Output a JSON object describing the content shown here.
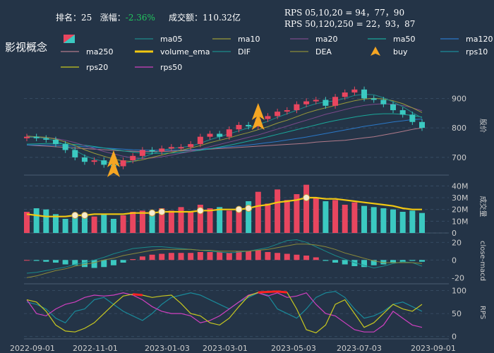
{
  "header": {
    "rank_label": "排名：",
    "rank_value": "25",
    "change_label": "涨幅：",
    "change_value": "-2.36%",
    "turnover_label": "成交额：",
    "turnover_value": "110.32亿",
    "rps_short": "RPS 05,10,20 = 94，77，90",
    "rps_long": "RPS 50,120,250 = 22，93，87"
  },
  "colors": {
    "background": "#243447",
    "up": "#e8465f",
    "down": "#3bc9c1",
    "volume_ema": "#f2c811",
    "buy": "#f5a623",
    "rps_high": "#ff2020"
  },
  "legend": [
    {
      "name": "",
      "color": "#e8465f",
      "icon": "candle-swatch-icon"
    },
    {
      "name": "ma05",
      "color": "#1f8a8a",
      "icon": "line"
    },
    {
      "name": "ma10",
      "color": "#9a9a3a",
      "icon": "line"
    },
    {
      "name": "ma20",
      "color": "#7a4a8a",
      "icon": "line"
    },
    {
      "name": "ma50",
      "color": "#1aa89a",
      "icon": "line"
    },
    {
      "name": "ma120",
      "color": "#2a78c8",
      "icon": "line"
    },
    {
      "name": "ma250",
      "color": "#b07a8a",
      "icon": "line"
    },
    {
      "name": "volume_ema",
      "color": "#f2c811",
      "icon": "thick-line"
    },
    {
      "name": "DIF",
      "color": "#1a8a8a",
      "icon": "line"
    },
    {
      "name": "DEA",
      "color": "#8a8a3a",
      "icon": "line"
    },
    {
      "name": "buy",
      "color": "#f5a623",
      "icon": "buy-arrow-icon"
    },
    {
      "name": "rps10",
      "color": "#1a8a9a",
      "icon": "line"
    },
    {
      "name": "rps20",
      "color": "#c8c820",
      "icon": "line"
    },
    {
      "name": "rps50",
      "color": "#d040c0",
      "icon": "line"
    }
  ],
  "chart_data": {
    "type": "line",
    "title": "影视概念",
    "x_ticks": [
      "2022-09-01",
      "2022-11-01",
      "2023-01-03",
      "2023-03-01",
      "2023-05-03",
      "2023-07-03",
      "2023-09-01"
    ],
    "price": {
      "ylabel": "股价",
      "ylim": [
        640,
        975
      ],
      "yticks": [
        700,
        800,
        900
      ],
      "close": [
        770,
        765,
        760,
        745,
        725,
        700,
        685,
        690,
        675,
        670,
        690,
        705,
        725,
        720,
        730,
        735,
        735,
        745,
        770,
        780,
        770,
        795,
        810,
        805,
        830,
        840,
        855,
        860,
        880,
        890,
        895,
        875,
        905,
        920,
        930,
        900,
        895,
        880,
        860,
        845,
        820,
        800
      ],
      "ma05": [
        770,
        768,
        764,
        756,
        742,
        724,
        706,
        694,
        686,
        678,
        680,
        686,
        700,
        712,
        724,
        730,
        734,
        738,
        748,
        760,
        770,
        780,
        790,
        800,
        812,
        822,
        836,
        848,
        860,
        872,
        882,
        888,
        892,
        900,
        910,
        914,
        912,
        902,
        888,
        872,
        852,
        834
      ],
      "ma10": [
        772,
        770,
        768,
        762,
        752,
        740,
        726,
        714,
        704,
        694,
        688,
        686,
        692,
        700,
        708,
        716,
        724,
        732,
        740,
        750,
        758,
        766,
        776,
        784,
        794,
        804,
        816,
        826,
        838,
        850,
        860,
        868,
        876,
        884,
        892,
        898,
        900,
        898,
        892,
        882,
        868,
        852
      ],
      "ma20": [
        768,
        768,
        767,
        764,
        758,
        750,
        740,
        730,
        720,
        712,
        704,
        698,
        696,
        698,
        702,
        708,
        714,
        720,
        728,
        736,
        744,
        752,
        760,
        768,
        776,
        786,
        796,
        806,
        816,
        826,
        836,
        846,
        854,
        862,
        870,
        876,
        880,
        882,
        880,
        876,
        868,
        858
      ],
      "ma50": [
        745,
        746,
        747,
        747,
        746,
        744,
        741,
        737,
        732,
        727,
        722,
        718,
        715,
        714,
        714,
        715,
        717,
        720,
        724,
        729,
        735,
        741,
        748,
        755,
        762,
        770,
        778,
        786,
        794,
        802,
        810,
        818,
        825,
        831,
        837,
        842,
        846,
        848,
        848,
        846,
        842,
        837
      ],
      "ma120": [
        742,
        742,
        742,
        741,
        740,
        738,
        736,
        734,
        732,
        730,
        728,
        726,
        725,
        724,
        724,
        724,
        725,
        726,
        728,
        730,
        733,
        736,
        739,
        742,
        746,
        750,
        754,
        759,
        764,
        769,
        775,
        781,
        787,
        793,
        799,
        805,
        810,
        815,
        820,
        824,
        828,
        830
      ],
      "ma250": [
        742,
        740,
        738,
        736,
        734,
        732,
        730,
        728,
        726,
        724,
        722,
        721,
        720,
        720,
        720,
        721,
        722,
        724,
        726,
        728,
        730,
        732,
        734,
        736,
        738,
        740,
        742,
        744,
        746,
        748,
        752,
        754,
        756,
        758,
        762,
        766,
        770,
        776,
        782,
        788,
        795,
        800
      ],
      "buy_signals": [
        {
          "x": 9,
          "y": 700
        },
        {
          "x": 24,
          "y": 860
        }
      ]
    },
    "volume": {
      "ylabel": "成交量",
      "ylim": [
        0,
        45
      ],
      "unit": "M",
      "yticks": [
        "0",
        "10M",
        "20M",
        "30M",
        "40M"
      ],
      "values": [
        18,
        21,
        20,
        16,
        12,
        15,
        17,
        14,
        16,
        12,
        15,
        18,
        19,
        17,
        21,
        19,
        22,
        18,
        24,
        21,
        22,
        19,
        20,
        27,
        35,
        25,
        37,
        28,
        33,
        41,
        30,
        27,
        28,
        24,
        26,
        23,
        22,
        21,
        20,
        18,
        19,
        17
      ],
      "ema": [
        16,
        15,
        14,
        14,
        14,
        15,
        15,
        16,
        16,
        16,
        16,
        17,
        17,
        17,
        18,
        18,
        18,
        18,
        19,
        19,
        20,
        20,
        20,
        21,
        23,
        24,
        26,
        27,
        28,
        30,
        30,
        29,
        29,
        28,
        27,
        26,
        25,
        24,
        23,
        21,
        20,
        20
      ],
      "markers": [
        5,
        6,
        13,
        14,
        18,
        22,
        23,
        29
      ]
    },
    "macd": {
      "ylabel": "close-macd",
      "ylim": [
        -27,
        25
      ],
      "yticks": [
        -20,
        0,
        20
      ],
      "hist": [
        0,
        -1,
        -2,
        -3,
        -5,
        -6,
        -8,
        -9,
        -8,
        -6,
        -3,
        1,
        4,
        6,
        7,
        8,
        8,
        8,
        9,
        9,
        9,
        8,
        10,
        10,
        11,
        9,
        8,
        7,
        6,
        5,
        3,
        -1,
        -3,
        -5,
        -7,
        -8,
        -6,
        -5,
        -3,
        -2,
        -1,
        -2
      ],
      "DIF": [
        -15,
        -14,
        -12,
        -10,
        -8,
        -5,
        -3,
        0,
        3,
        7,
        10,
        13,
        14,
        15,
        15,
        14,
        13,
        12,
        11,
        10,
        9,
        8,
        9,
        10,
        12,
        14,
        18,
        22,
        23,
        20,
        15,
        10,
        5,
        1,
        -3,
        -6,
        -9,
        -7,
        -4,
        -2,
        -3,
        -7
      ],
      "DEA": [
        -20,
        -18,
        -15,
        -12,
        -10,
        -7,
        -5,
        -3,
        0,
        2,
        5,
        7,
        9,
        11,
        12,
        12,
        12,
        12,
        11,
        11,
        10,
        10,
        10,
        10,
        11,
        12,
        14,
        16,
        18,
        18,
        17,
        15,
        12,
        8,
        5,
        2,
        -1,
        -3,
        -3,
        -3,
        -3,
        -4
      ]
    },
    "rps": {
      "ylabel": "RPS",
      "ylim": [
        -5,
        110
      ],
      "yticks": [
        0,
        50,
        100
      ],
      "rps10": [
        75,
        70,
        60,
        40,
        30,
        55,
        60,
        80,
        85,
        70,
        55,
        45,
        35,
        50,
        70,
        85,
        90,
        95,
        90,
        80,
        70,
        60,
        75,
        85,
        95,
        90,
        60,
        50,
        40,
        60,
        85,
        95,
        98,
        85,
        60,
        40,
        45,
        55,
        70,
        75,
        65,
        55
      ],
      "rps20": [
        80,
        75,
        55,
        25,
        12,
        10,
        18,
        30,
        50,
        70,
        88,
        92,
        90,
        85,
        88,
        90,
        72,
        50,
        45,
        30,
        25,
        40,
        65,
        88,
        96,
        97,
        98,
        96,
        60,
        15,
        8,
        25,
        70,
        80,
        50,
        20,
        30,
        50,
        70,
        60,
        55,
        70
      ],
      "rps50": [
        80,
        50,
        45,
        60,
        70,
        75,
        85,
        90,
        88,
        90,
        95,
        90,
        80,
        65,
        55,
        50,
        50,
        45,
        30,
        35,
        45,
        60,
        75,
        90,
        95,
        88,
        95,
        85,
        88,
        95,
        70,
        50,
        45,
        30,
        15,
        10,
        10,
        25,
        55,
        40,
        25,
        20
      ]
    }
  }
}
